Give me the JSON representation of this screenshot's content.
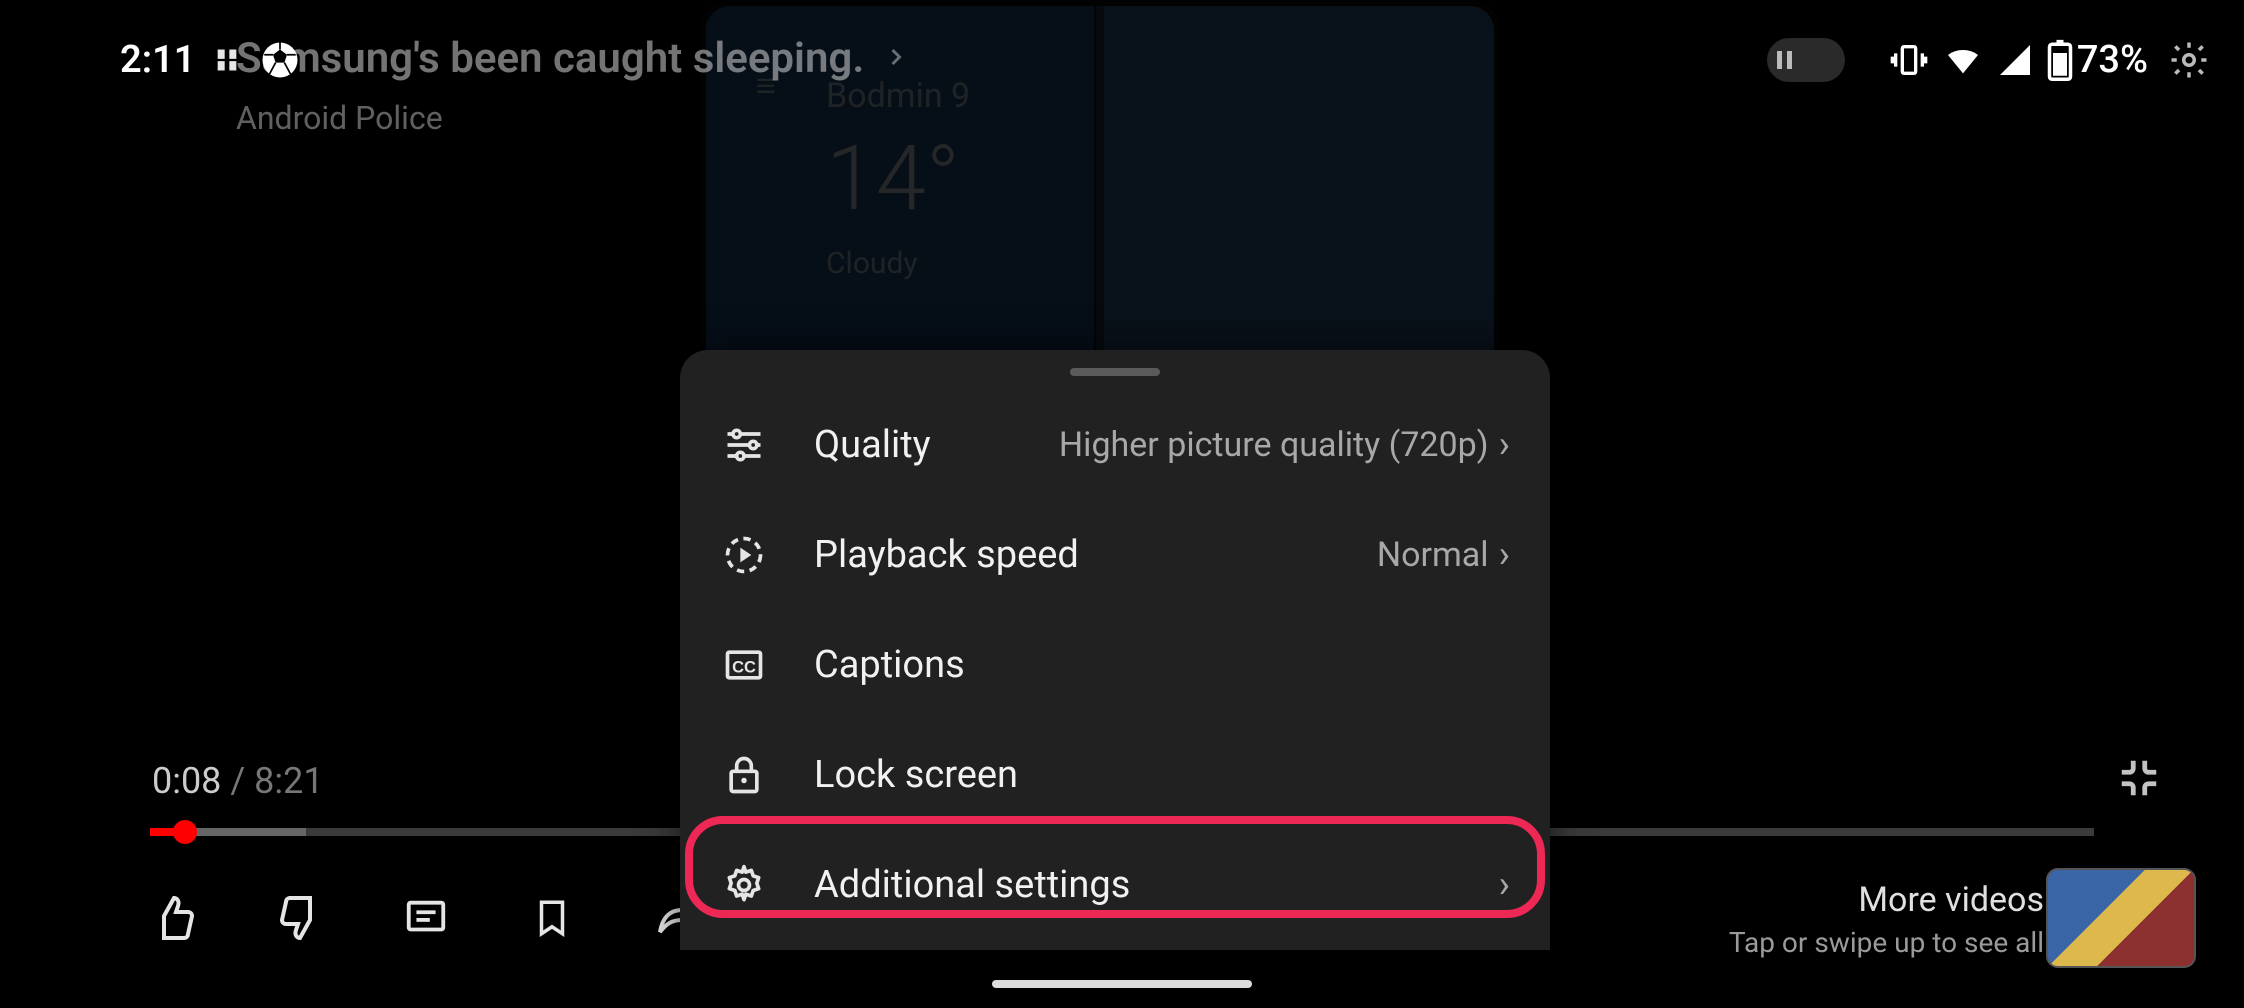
{
  "statusbar": {
    "time": "2:11",
    "battery_percent": "73%"
  },
  "video": {
    "title": "Samsung's been caught sleeping.",
    "channel": "Android Police",
    "elapsed": "0:08",
    "duration": "8:21"
  },
  "weather_frame": {
    "location": "Bodmin 9",
    "temp": "14°",
    "condition": "Cloudy"
  },
  "sheet": {
    "items": [
      {
        "label": "Quality",
        "value": "Higher picture quality (720p)",
        "chevron": "›"
      },
      {
        "label": "Playback speed",
        "value": "Normal",
        "chevron": "›"
      },
      {
        "label": "Captions",
        "value": "",
        "chevron": ""
      },
      {
        "label": "Lock screen",
        "value": "",
        "chevron": ""
      },
      {
        "label": "Additional settings",
        "value": "",
        "chevron": "›"
      }
    ]
  },
  "more": {
    "title": "More videos",
    "hint": "Tap or swipe up to see all"
  }
}
